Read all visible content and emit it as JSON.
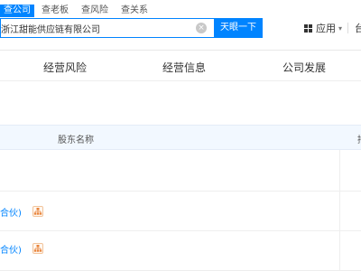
{
  "header": {
    "search_tabs": [
      "查公司",
      "查老板",
      "查风险",
      "查关系"
    ],
    "search_value": "浙江甜能供应链有限公司",
    "search_button_label": "天眼一下",
    "apps_label": "应用",
    "cut_char": "台"
  },
  "nav": {
    "items": [
      "经营风险",
      "经营信息",
      "公司发展"
    ]
  },
  "table": {
    "header_label": "股东名称",
    "header_cut": "持",
    "rows": [
      {
        "holder": ""
      },
      {
        "holder": "合伙)"
      },
      {
        "holder": "合伙)"
      }
    ]
  },
  "colors": {
    "accent": "#0084ff",
    "table_header_bg": "#f2f8ff",
    "org_icon": "#e8833a"
  }
}
